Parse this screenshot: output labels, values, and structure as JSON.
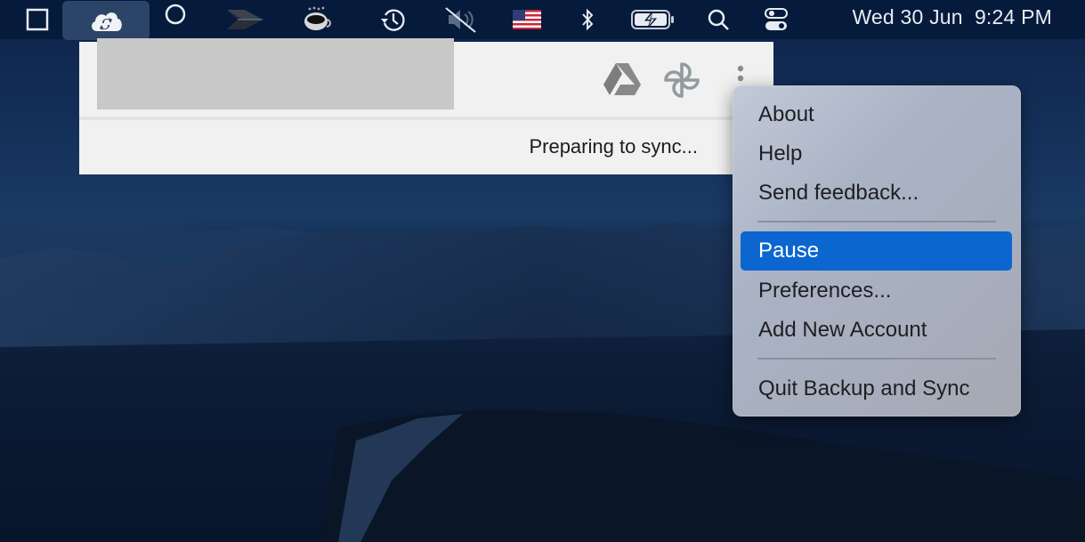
{
  "menubar": {
    "icons": [
      {
        "name": "window-square-icon"
      },
      {
        "name": "backup-and-sync-cloud-icon",
        "active": true
      },
      {
        "name": "circle-icon"
      },
      {
        "name": "double-chevron-icon"
      },
      {
        "name": "coffee-cup-icon"
      },
      {
        "name": "time-machine-icon"
      },
      {
        "name": "volume-muted-icon"
      },
      {
        "name": "us-flag-input-source-icon"
      },
      {
        "name": "bluetooth-icon"
      },
      {
        "name": "battery-charging-icon"
      },
      {
        "name": "spotlight-search-icon"
      },
      {
        "name": "control-center-icon"
      }
    ],
    "clock": "Wed 30 Jun  9:24 PM"
  },
  "popup": {
    "header_icons": [
      {
        "name": "google-drive-icon"
      },
      {
        "name": "google-photos-icon"
      },
      {
        "name": "more-options-icon"
      }
    ],
    "status": "Preparing to sync..."
  },
  "context_menu": {
    "groups": [
      [
        {
          "label": "About"
        },
        {
          "label": "Help"
        },
        {
          "label": "Send feedback..."
        }
      ],
      [
        {
          "label": "Pause",
          "highlighted": true
        },
        {
          "label": "Preferences..."
        },
        {
          "label": "Add New Account"
        }
      ],
      [
        {
          "label": "Quit Backup and Sync"
        }
      ]
    ]
  },
  "colors": {
    "menubar_bg": "#061a3c",
    "highlight": "#0b66cf",
    "popup_bg": "#f1f1f1"
  }
}
